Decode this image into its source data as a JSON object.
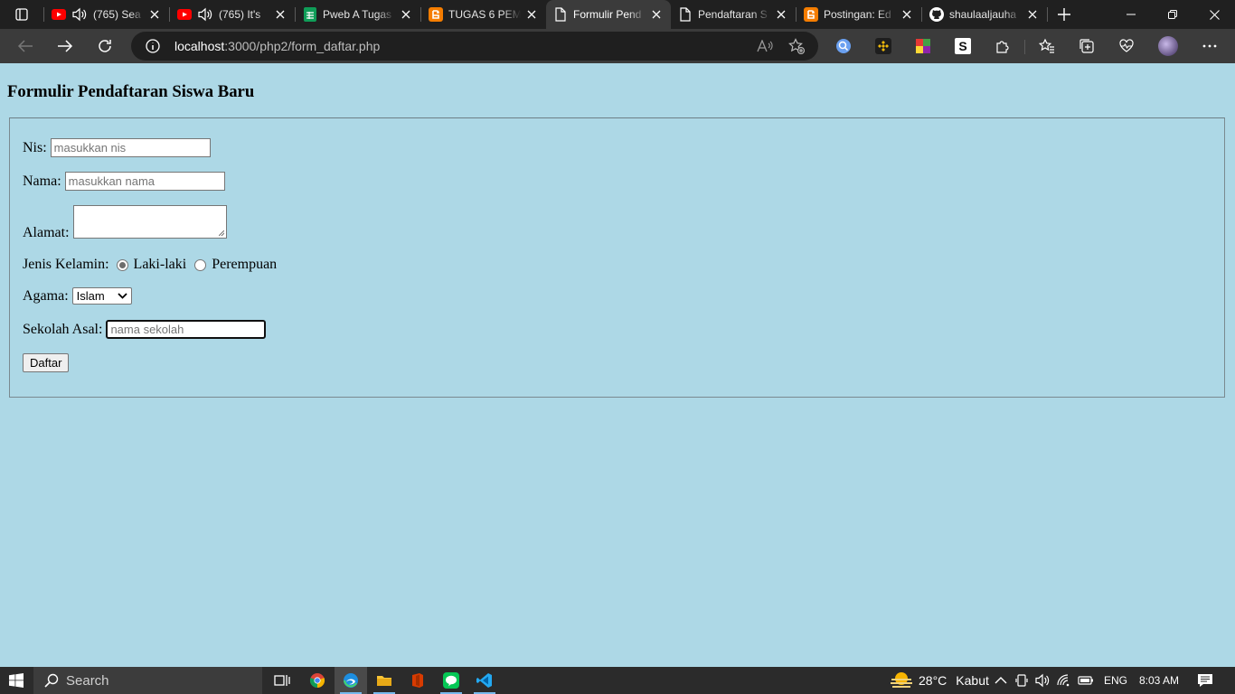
{
  "browser": {
    "tabs": [
      {
        "title": "(765) Sea",
        "favicon": "youtube-icon",
        "audio": true
      },
      {
        "title": "(765) It's",
        "favicon": "youtube-icon",
        "audio": true
      },
      {
        "title": "Pweb A Tugas",
        "favicon": "google-sheets-icon",
        "audio": false
      },
      {
        "title": "TUGAS 6 PEM",
        "favicon": "blogger-icon",
        "audio": false
      },
      {
        "title": "Formulir Pend",
        "favicon": "page-icon",
        "audio": false,
        "active": true
      },
      {
        "title": "Pendaftaran S",
        "favicon": "page-icon",
        "audio": false
      },
      {
        "title": "Postingan: Ed",
        "favicon": "blogger-icon",
        "audio": false
      },
      {
        "title": "shaulaaljauha",
        "favicon": "github-icon",
        "audio": false
      }
    ],
    "address": {
      "host": "localhost",
      "path": ":3000/php2/form_daftar.php"
    }
  },
  "form": {
    "heading": "Formulir Pendaftaran Siswa Baru",
    "nis": {
      "label": "Nis:",
      "placeholder": "masukkan nis"
    },
    "nama": {
      "label": "Nama:",
      "placeholder": "masukkan nama"
    },
    "alamat": {
      "label": "Alamat:"
    },
    "gender": {
      "label": "Jenis Kelamin:",
      "options": [
        "Laki-laki",
        "Perempuan"
      ],
      "selected": "Laki-laki"
    },
    "agama": {
      "label": "Agama:",
      "selected": "Islam"
    },
    "sekolah": {
      "label": "Sekolah Asal:",
      "placeholder": "nama sekolah"
    },
    "submit_label": "Daftar"
  },
  "taskbar": {
    "search_label": "Search",
    "weather": {
      "temp": "28°C",
      "condition": "Kabut"
    },
    "language": "ENG",
    "time": "8:03 AM"
  },
  "colors": {
    "page_bg": "#add8e6",
    "tab_bar": "#202020",
    "toolbar": "#3b3b3b"
  }
}
